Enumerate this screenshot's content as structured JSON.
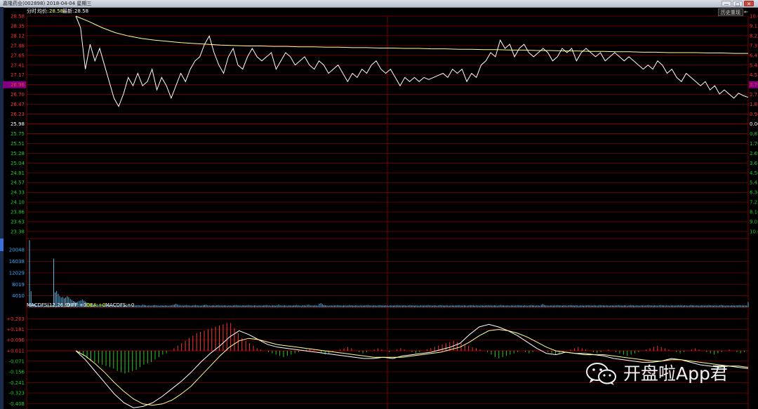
{
  "app": {
    "title": "嘉隆药业(002898) 2018-04-04 星期三",
    "minimize": "—",
    "maximize": "□",
    "close": "✕",
    "replay_label": "历史重现",
    "expand_label": "⇤"
  },
  "info_bar": {
    "label": "分时",
    "avg_label": "均价:",
    "avg_value": "28.58",
    "latest_label": "最新:",
    "latest_value": "28.58"
  },
  "colors": {
    "grid": "#7a0000",
    "price_line": "#ffffff",
    "avg_line": "#ffff99",
    "up": "#ff3333",
    "down": "#22cc22",
    "neutral": "#ffffff",
    "axis_blue": "#33aaff",
    "volume": "#66ccff",
    "highlight": "#800080",
    "dea": "#ffff00"
  },
  "chart_data": [
    {
      "type": "line",
      "name": "price-panel",
      "ylim": [
        23.38,
        28.58
      ],
      "y_ticks_left": [
        "28.58",
        "28.35",
        "28.12",
        "27.88",
        "27.65",
        "27.41",
        "27.17",
        "26.96",
        "26.70",
        "26.47",
        "26.23",
        "25.98",
        "25.75",
        "25.51",
        "25.28",
        "25.04",
        "24.81",
        "24.57",
        "24.33",
        "24.10",
        "23.86",
        "23.63",
        "23.38"
      ],
      "highlighted_tick": "26.96",
      "y_ticks_right": [
        "10.0",
        "9.12",
        "8.23",
        "7.35",
        "6.42",
        "5.48",
        "4.53",
        "3.70",
        "2.75",
        "1.87",
        "0.94",
        "0.00",
        "0.87",
        "1.76",
        "2.69",
        "3.61",
        "4.50",
        "5.43",
        "6.34",
        "7.22",
        "8.16",
        "9.05",
        "10.0"
      ],
      "highlighted_right_tick": "3.70",
      "series": [
        {
          "role": "price",
          "y": [
            28.58,
            28.3,
            27.3,
            27.9,
            27.5,
            27.8,
            27.4,
            27.0,
            26.6,
            26.4,
            26.7,
            27.1,
            26.9,
            27.2,
            26.9,
            27.0,
            27.3,
            26.8,
            27.1,
            26.9,
            26.6,
            26.9,
            27.2,
            27.0,
            27.3,
            27.5,
            27.6,
            27.9,
            28.1,
            27.7,
            27.4,
            27.2,
            27.6,
            27.8,
            27.4,
            27.3,
            27.6,
            27.8,
            27.6,
            27.5,
            27.6,
            27.7,
            27.3,
            27.5,
            27.7,
            27.6,
            27.4,
            27.5,
            27.6,
            27.4,
            27.3,
            27.5,
            27.4,
            27.2,
            27.3,
            27.4,
            27.2,
            27.0,
            27.2,
            27.1,
            27.3,
            27.2,
            27.4,
            27.5,
            27.3,
            27.2,
            27.3,
            27.1,
            26.9,
            27.1,
            27.0,
            27.1,
            27.0,
            27.1,
            27.05,
            27.1,
            27.15,
            27.2,
            27.1,
            27.3,
            27.2,
            27.3,
            27.0,
            27.2,
            27.1,
            27.4,
            27.5,
            27.7,
            27.6,
            28.0,
            27.8,
            27.9,
            27.6,
            27.8,
            27.9,
            27.7,
            27.6,
            27.7,
            27.8,
            27.7,
            27.5,
            27.6,
            27.8,
            27.7,
            27.8,
            27.5,
            27.7,
            27.8,
            27.7,
            27.6,
            27.7,
            27.5,
            27.6,
            27.7,
            27.6,
            27.5,
            27.6,
            27.5,
            27.4,
            27.3,
            27.4,
            27.3,
            27.5,
            27.4,
            27.2,
            27.3,
            27.1,
            27.0,
            27.2,
            27.1,
            27.0,
            26.9,
            27.0,
            26.8,
            26.9,
            26.7,
            26.8,
            26.7,
            26.6,
            26.72,
            26.66,
            26.62
          ]
        },
        {
          "role": "average",
          "y": [
            28.58,
            28.45,
            28.3,
            28.18,
            28.1,
            28.04,
            28.0,
            27.97,
            27.94,
            27.92,
            27.9,
            27.88,
            27.87,
            27.86,
            27.86,
            27.85,
            27.85,
            27.84,
            27.84,
            27.83,
            27.83,
            27.82,
            27.82,
            27.81,
            27.81,
            27.8,
            27.8,
            27.79,
            27.79,
            27.78,
            27.78,
            27.77,
            27.77,
            27.76,
            27.76,
            27.75,
            27.75,
            27.74,
            27.74,
            27.73,
            27.73,
            27.72,
            27.72,
            27.71,
            27.71,
            27.7,
            27.7,
            27.7,
            27.69,
            27.69,
            27.68,
            27.68
          ]
        }
      ]
    },
    {
      "type": "bar",
      "name": "volume-panel",
      "y_ticks": [
        "20048",
        "16038",
        "12029",
        "8019",
        "4010"
      ],
      "ylim": [
        0,
        24000
      ],
      "values": [
        23400,
        5600,
        1500,
        1200,
        900,
        800,
        700,
        650,
        600,
        600,
        550,
        600,
        650,
        700,
        700,
        800,
        17000,
        5200,
        5700,
        4700,
        3900,
        3400,
        3600,
        3100,
        3400,
        3900,
        3500,
        2900,
        2600,
        2200,
        2000,
        1700,
        1900,
        2200,
        2400,
        2700,
        2300,
        2000,
        1700,
        1400,
        1300,
        1200,
        1100,
        1200,
        1000,
        900,
        800,
        850,
        900,
        800,
        700,
        750,
        800,
        700,
        650,
        700,
        750,
        700,
        700,
        650,
        600,
        650,
        700,
        800,
        700,
        650,
        600,
        700,
        750,
        700,
        650,
        700,
        800,
        700,
        650,
        900,
        800,
        700,
        600,
        700,
        650,
        600,
        700,
        800,
        700,
        650,
        600,
        700,
        650,
        600,
        700,
        650,
        600,
        650,
        700,
        800,
        900,
        1200,
        1000,
        800,
        700,
        650,
        600,
        700,
        800,
        700,
        650,
        600,
        650,
        700,
        800,
        700,
        650,
        600,
        650,
        700,
        800,
        900,
        700,
        650,
        600,
        700,
        650,
        600,
        700,
        800,
        700,
        650,
        600,
        700,
        650,
        600,
        700,
        650,
        600,
        650,
        700,
        800,
        700,
        650,
        600,
        700,
        650,
        600,
        700,
        800,
        700,
        650,
        600,
        700,
        650,
        600,
        700,
        650,
        600,
        650,
        700,
        800,
        700,
        650,
        600,
        700,
        650,
        600,
        700,
        900,
        700,
        650,
        600,
        700,
        650,
        600,
        700,
        650,
        600,
        650,
        700,
        800,
        700,
        650,
        600,
        700,
        650,
        600,
        800,
        900,
        700,
        650,
        600,
        700,
        650,
        600,
        1200,
        1500,
        1100,
        800,
        700,
        650,
        600,
        700,
        650,
        600,
        650,
        700,
        800,
        700,
        650,
        600,
        700,
        650,
        600,
        700,
        800,
        700,
        650,
        600,
        700,
        650,
        600,
        700,
        650,
        600,
        650,
        700,
        800,
        700,
        650,
        600,
        700,
        650,
        600,
        700,
        800,
        700,
        650,
        600,
        700,
        650,
        600,
        700,
        650,
        600,
        650,
        700,
        800,
        700,
        650,
        600,
        700,
        650,
        600,
        700,
        800,
        700,
        650,
        600,
        700,
        650,
        600,
        700,
        650,
        600,
        650,
        700,
        800,
        700,
        650,
        600,
        700,
        650,
        600,
        700,
        800,
        700,
        650,
        600,
        700,
        650,
        600,
        700,
        650,
        600,
        650,
        700,
        800,
        700,
        650,
        600,
        700,
        650,
        600,
        700,
        800,
        700,
        650,
        600,
        700,
        650,
        600,
        700,
        650,
        600,
        650,
        700,
        800,
        700,
        650,
        600,
        700,
        650,
        600,
        700,
        800,
        700,
        650,
        600,
        700,
        650,
        600,
        700,
        650,
        600,
        650,
        700,
        800,
        700,
        650,
        600,
        700,
        650,
        600,
        700,
        800,
        700,
        650,
        600,
        700,
        650,
        600,
        900,
        1100,
        800,
        700,
        650,
        600,
        700,
        650,
        600,
        650,
        700,
        800,
        700,
        650,
        600,
        700,
        650,
        600,
        700,
        800,
        700,
        650,
        600,
        700,
        650,
        600,
        700,
        650,
        600,
        650,
        700,
        800,
        700,
        650,
        600,
        700,
        650,
        600,
        700,
        800,
        700,
        650,
        600,
        700,
        650,
        600,
        700,
        650,
        600,
        650,
        700,
        800,
        700,
        650,
        600,
        700,
        650,
        600,
        700,
        800,
        700,
        650,
        600,
        700,
        650,
        600,
        700,
        650,
        600,
        650,
        700,
        800,
        700,
        650,
        600,
        700,
        650,
        600,
        700,
        800,
        700,
        650,
        600,
        700,
        650,
        600,
        700,
        650,
        600,
        650,
        700,
        800,
        700,
        650,
        600,
        700,
        650,
        600,
        700,
        800,
        700,
        650,
        600,
        700,
        650,
        600,
        700,
        650,
        600,
        650,
        700,
        800,
        700,
        650,
        600,
        700,
        650,
        600,
        700,
        800,
        700,
        650,
        600,
        700,
        650,
        600,
        700,
        650,
        600,
        650,
        700,
        800,
        700,
        650,
        600,
        700,
        650,
        1800
      ]
    },
    {
      "type": "line",
      "name": "macd-panel",
      "legend": {
        "title": "MACDFS(12,26,9)",
        "diff_label": "DIFF:",
        "diff_value": "+0",
        "dea_label": "DEA:",
        "dea_value": "+0",
        "macd_label": "MACDFS:",
        "macd_value": "+0"
      },
      "y_ticks": [
        "+0.263",
        "+0.181",
        "+0.096",
        "+0.011",
        "-0.071",
        "-0.156",
        "-0.241",
        "-0.323",
        "-0.408"
      ],
      "ylim": [
        -0.45,
        0.3
      ],
      "series": [
        {
          "role": "diff",
          "y": [
            0.011,
            -0.06,
            -0.15,
            -0.24,
            -0.33,
            -0.4,
            -0.44,
            -0.43,
            -0.4,
            -0.35,
            -0.29,
            -0.23,
            -0.16,
            -0.08,
            -0.01,
            0.05,
            0.12,
            0.17,
            0.14,
            0.1,
            0.06,
            0.04,
            0.03,
            0.02,
            0.01,
            0.0,
            -0.01,
            -0.02,
            -0.03,
            -0.04,
            -0.05,
            -0.05,
            -0.04,
            -0.05,
            -0.03,
            -0.02,
            -0.01,
            0.0,
            0.02,
            0.04,
            0.07,
            0.14,
            0.2,
            0.22,
            0.2,
            0.17,
            0.13,
            0.08,
            0.03,
            -0.01,
            -0.02,
            0.0,
            -0.01,
            -0.02,
            -0.02,
            -0.03,
            -0.05,
            -0.06,
            -0.07,
            -0.08,
            -0.08,
            -0.07,
            -0.05,
            -0.06,
            -0.08,
            -0.1,
            -0.11,
            -0.12,
            -0.11,
            -0.12,
            -0.13
          ]
        },
        {
          "role": "dea",
          "y": [
            0.011,
            -0.03,
            -0.09,
            -0.16,
            -0.24,
            -0.31,
            -0.37,
            -0.41,
            -0.42,
            -0.41,
            -0.38,
            -0.33,
            -0.27,
            -0.19,
            -0.11,
            -0.03,
            0.04,
            0.09,
            0.11,
            0.1,
            0.08,
            0.06,
            0.05,
            0.04,
            0.03,
            0.02,
            0.01,
            0.0,
            -0.01,
            -0.02,
            -0.03,
            -0.04,
            -0.04,
            -0.04,
            -0.04,
            -0.03,
            -0.02,
            -0.01,
            0.0,
            0.02,
            0.04,
            0.08,
            0.13,
            0.17,
            0.18,
            0.17,
            0.15,
            0.12,
            0.08,
            0.04,
            0.01,
            0.0,
            -0.01,
            -0.01,
            -0.02,
            -0.02,
            -0.03,
            -0.04,
            -0.05,
            -0.06,
            -0.07,
            -0.07,
            -0.06,
            -0.06,
            -0.07,
            -0.08,
            -0.09,
            -0.1,
            -0.11,
            -0.11,
            -0.12
          ]
        },
        {
          "role": "histogram",
          "y": [
            0,
            -0.02,
            -0.04,
            -0.06,
            -0.08,
            -0.09,
            -0.1,
            -0.11,
            -0.12,
            -0.13,
            -0.14,
            -0.16,
            -0.17,
            -0.18,
            -0.17,
            -0.16,
            -0.15,
            -0.13,
            -0.11,
            -0.1,
            -0.09,
            -0.07,
            -0.05,
            -0.03,
            -0.02,
            0.0,
            0.02,
            0.04,
            0.06,
            0.08,
            0.1,
            0.12,
            0.14,
            0.15,
            0.16,
            0.17,
            0.18,
            0.19,
            0.2,
            0.21,
            0.22,
            0.22,
            0.18,
            0.14,
            0.1,
            0.08,
            0.06,
            0.04,
            0.02,
            0.01,
            0.0,
            -0.01,
            -0.02,
            -0.03,
            -0.04,
            -0.05,
            -0.04,
            -0.03,
            -0.02,
            -0.01,
            0.0,
            0.01,
            0.02,
            0.01,
            0.0,
            -0.02,
            -0.03,
            -0.02,
            -0.01,
            0.0,
            0.01,
            0.02,
            0.03,
            0.02,
            0.0,
            -0.01,
            -0.02,
            -0.01,
            0.0,
            0.01,
            0.02,
            0.01,
            0.0,
            -0.01,
            0.0,
            0.01,
            0.02,
            0.01,
            0.0,
            -0.01,
            -0.02,
            -0.01,
            0.0,
            0.01,
            0.02,
            0.03,
            0.04,
            0.05,
            0.06,
            0.07,
            0.08,
            0.07,
            0.06,
            0.05,
            0.04,
            0.03,
            0.02,
            0.01,
            0.0,
            -0.01,
            -0.03,
            -0.05,
            -0.06,
            -0.05,
            -0.04,
            -0.03,
            -0.02,
            -0.01,
            0.0,
            -0.01,
            -0.02,
            -0.01,
            0.0,
            0.01,
            0.0,
            -0.01,
            -0.02,
            -0.03,
            -0.02,
            -0.01,
            0.0,
            0.01,
            0.02,
            0.03,
            0.02,
            0.01,
            0.0,
            -0.01,
            -0.02,
            -0.01,
            0.0,
            0.01,
            0.0,
            -0.01,
            -0.02,
            -0.03,
            -0.04,
            -0.03,
            -0.02,
            -0.01,
            0.0,
            0.01,
            0.02,
            0.03,
            0.04,
            0.03,
            0.02,
            0.01,
            0.0,
            -0.01,
            -0.02,
            -0.01,
            0.0,
            0.01,
            0.02,
            0.01,
            0.0,
            -0.01,
            -0.02,
            -0.03,
            -0.02,
            -0.01,
            0.0,
            0.01,
            0.0,
            -0.01,
            -0.02,
            -0.01,
            0.0
          ]
        }
      ]
    }
  ],
  "watermark": {
    "text": "开盘啦App君"
  }
}
